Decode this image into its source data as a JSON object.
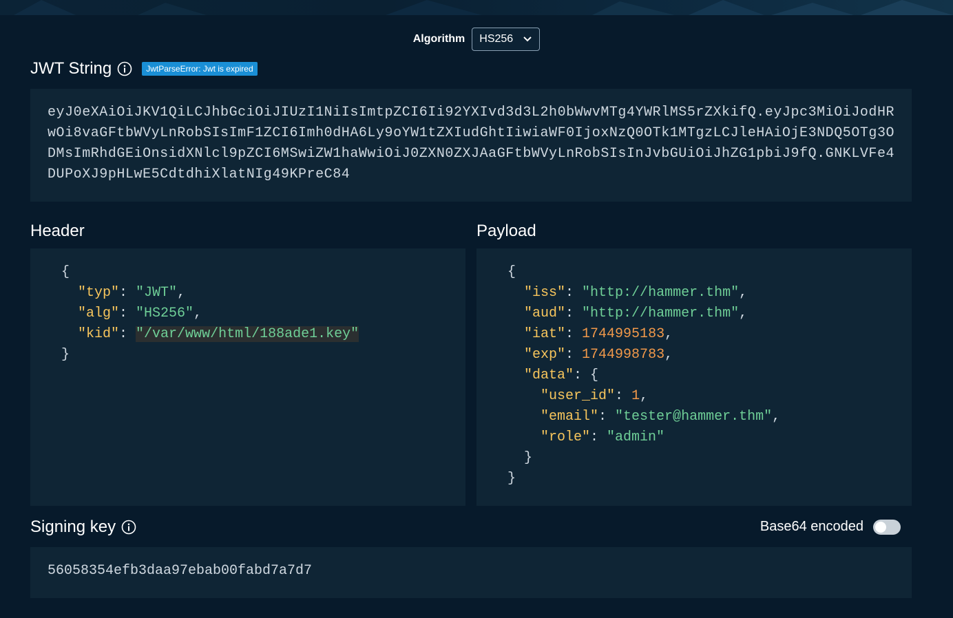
{
  "algorithm": {
    "label": "Algorithm",
    "selected": "HS256"
  },
  "jwt": {
    "title": "JWT String",
    "error_badge": "JwtParseError: Jwt is expired",
    "token": "eyJ0eXAiOiJKV1QiLCJhbGciOiJIUzI1NiIsImtpZCI6Ii92YXIvd3d3L2h0bWwvMTg4YWRlMS5rZXkifQ.eyJpc3MiOiJodHRwOi8vaGFtbWVyLnRobSIsImF1ZCI6Imh0dHA6Ly9oYW1tZXIudGhtIiwiaWF0IjoxNzQ0OTk1MTgzLCJleHAiOjE3NDQ5OTg3ODMsImRhdGEiOnsidXNlcl9pZCI6MSwiZW1haWwiOiJ0ZXN0ZXJAaGFtbWVyLnRobSIsInJvbGUiOiJhZG1pbiJ9fQ.GNKLVFe4DUPoXJ9pHLwE5CdtdhiXlatNIg49KPreC84"
  },
  "header": {
    "title": "Header",
    "open": "{",
    "close": "}",
    "fields": [
      {
        "key": "\"typ\"",
        "value": "\"JWT\""
      },
      {
        "key": "\"alg\"",
        "value": "\"HS256\""
      },
      {
        "key": "\"kid\"",
        "value": "\"/var/www/html/188ade1.key\""
      }
    ]
  },
  "payload": {
    "title": "Payload",
    "open": "{",
    "close": "}",
    "fields": [
      {
        "key": "\"iss\"",
        "value": "\"http://hammer.thm\""
      },
      {
        "key": "\"aud\"",
        "value": "\"http://hammer.thm\""
      },
      {
        "key": "\"iat\"",
        "value": "1744995183"
      },
      {
        "key": "\"exp\"",
        "value": "1744998783"
      },
      {
        "key": "\"data\"",
        "value": "{"
      }
    ],
    "data_fields": [
      {
        "key": "\"user_id\"",
        "value": "1"
      },
      {
        "key": "\"email\"",
        "value": "\"tester@hammer.thm\""
      },
      {
        "key": "\"role\"",
        "value": "\"admin\""
      }
    ],
    "data_close": "}"
  },
  "signing": {
    "title": "Signing key",
    "base64_label": "Base64 encoded",
    "base64_enabled": false,
    "key": "56058354efb3daa97ebab00fabd7a7d7"
  },
  "colors": {
    "background": "#071a2b",
    "panel": "#0f2535",
    "badge": "#1a8fd6",
    "json_key": "#f7c55c",
    "json_string": "#6fcf97",
    "json_number": "#f2994a"
  }
}
